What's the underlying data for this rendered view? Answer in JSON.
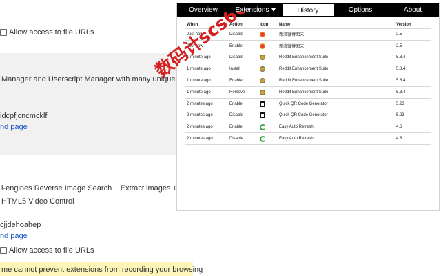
{
  "background": {
    "row1_label": "Allow access to file URLs",
    "row2_text": "Manager and Userscript Manager with many unique",
    "row3_id": "idcpfjcncmcklf",
    "row4_link": "nd page",
    "row5_text": "i-engines Reverse Image Search + Extract images +",
    "row6_text": "HTML5 Video Control",
    "row7_id": "cjjdehoahep",
    "row8_link": "nd page",
    "row9_label": "Allow access to file URLs",
    "warning_text": "me cannot prevent extensions from recording your browsing"
  },
  "popup": {
    "tabs": [
      {
        "label": "Overview"
      },
      {
        "label": "Extensions"
      },
      {
        "label": "History"
      },
      {
        "label": "Options"
      },
      {
        "label": "About"
      }
    ],
    "active_tab": "History",
    "columns": {
      "when": "When",
      "action": "Action",
      "icon": "Icon",
      "name": "Name",
      "version": "Version"
    },
    "rows": [
      {
        "when": "Just now",
        "action": "Disable",
        "icon": "weibo-icon",
        "name": "新浪微博图床",
        "version": "2.5"
      },
      {
        "when": "Just now",
        "action": "Enable",
        "icon": "weibo-icon",
        "name": "新浪微博图床",
        "version": "2.5"
      },
      {
        "when": "1 minute ago",
        "action": "Disable",
        "icon": "reddit-icon",
        "name": "Reddit Enhancement Suite",
        "version": "5.8.4"
      },
      {
        "when": "1 minute ago",
        "action": "Install",
        "icon": "reddit-icon",
        "name": "Reddit Enhancement Suite",
        "version": "5.8.4"
      },
      {
        "when": "1 minute ago",
        "action": "Enable",
        "icon": "reddit-icon",
        "name": "Reddit Enhancement Suite",
        "version": "5.8.4"
      },
      {
        "when": "1 minute ago",
        "action": "Remove",
        "icon": "reddit-icon",
        "name": "Reddit Enhancement Suite",
        "version": "5.8.4"
      },
      {
        "when": "2 minutes ago",
        "action": "Enable",
        "icon": "qr-icon",
        "name": "Quick QR Code Generator",
        "version": "5.23"
      },
      {
        "when": "2 minutes ago",
        "action": "Disable",
        "icon": "qr-icon",
        "name": "Quick QR Code Generator",
        "version": "5.23"
      },
      {
        "when": "2 minutes ago",
        "action": "Enable",
        "icon": "refresh-icon",
        "name": "Easy Auto Refresh",
        "version": "4.6"
      },
      {
        "when": "2 minutes ago",
        "action": "Disable",
        "icon": "refresh-icon",
        "name": "Easy Auto Refresh",
        "version": "4.6"
      }
    ]
  },
  "watermark": {
    "text": "数码计scs66",
    "color": "#d42020"
  }
}
